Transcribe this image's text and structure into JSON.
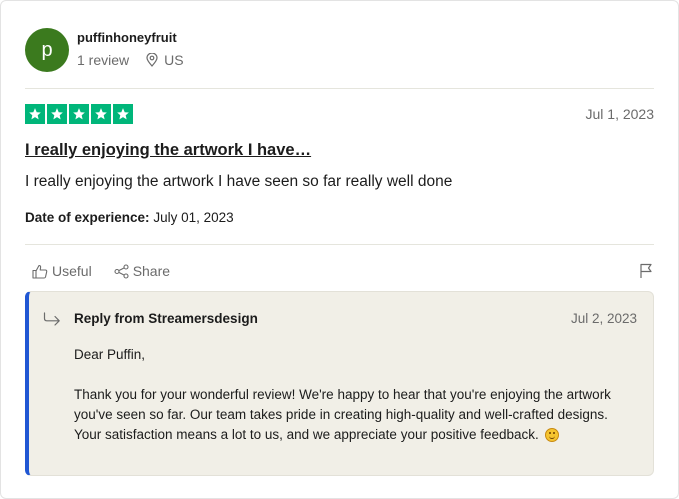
{
  "reviewer": {
    "initial": "p",
    "name": "puffinhoneyfruit",
    "review_count": "1 review",
    "country": "US",
    "avatar_color": "#3b7a1e"
  },
  "review": {
    "rating": 5,
    "max_rating": 5,
    "star_color": "#00b67a",
    "date": "Jul 1, 2023",
    "title": "I really enjoying the artwork I have…",
    "body": "I really enjoying the artwork I have seen so far really well done",
    "experience_label": "Date of experience:",
    "experience_date": "July 01, 2023"
  },
  "actions": {
    "useful_label": "Useful",
    "share_label": "Share",
    "report_icon": "flag-icon"
  },
  "reply": {
    "from": "Reply from Streamersdesign",
    "date": "Jul 2, 2023",
    "greeting": "Dear Puffin,",
    "text": "Thank you for your wonderful review! We're happy to hear that you're enjoying the artwork you've seen so far. Our team takes pride in creating high-quality and well-crafted designs. Your satisfaction means a lot to us, and we appreciate your positive feedback.",
    "emoji": "smiling-face-icon",
    "accent_color": "#2057d3"
  }
}
